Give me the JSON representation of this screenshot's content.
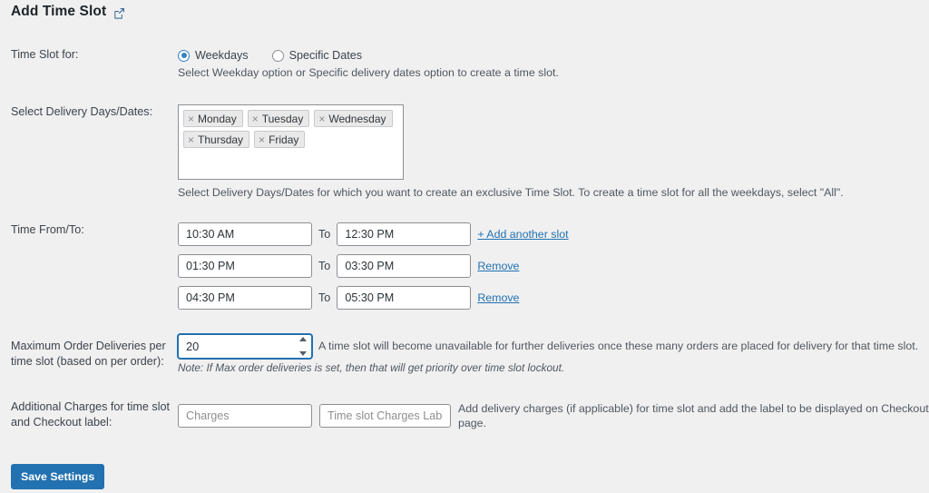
{
  "header": {
    "title": "Add Time Slot",
    "external_link_icon": "external-link-icon"
  },
  "form": {
    "time_slot_for": {
      "label": "Time Slot for:",
      "options": [
        {
          "label": "Weekdays",
          "selected": true
        },
        {
          "label": "Specific Dates",
          "selected": false
        }
      ],
      "help": "Select Weekday option or Specific delivery dates option to create a time slot."
    },
    "delivery_days": {
      "label": "Select Delivery Days/Dates:",
      "tags": [
        "Monday",
        "Tuesday",
        "Wednesday",
        "Thursday",
        "Friday"
      ],
      "remove_glyph": "×",
      "help": "Select Delivery Days/Dates for which you want to create an exclusive Time Slot. To create a time slot for all the weekdays, select \"All\"."
    },
    "time_from_to": {
      "label": "Time From/To:",
      "to_label": "To",
      "add_slot_link": "+ Add another slot",
      "remove_link": "Remove",
      "rows": [
        {
          "from": "10:30 AM",
          "to": "12:30 PM",
          "action": "add"
        },
        {
          "from": "01:30 PM",
          "to": "03:30 PM",
          "action": "remove"
        },
        {
          "from": "04:30 PM",
          "to": "05:30 PM",
          "action": "remove"
        }
      ]
    },
    "max_deliveries": {
      "label": "Maximum Order Deliveries per time slot (based on per order):",
      "value": "20",
      "help": "A time slot will become unavailable for further deliveries once these many orders are placed for delivery for that time slot.",
      "note": "Note: If Max order deliveries is set, then that will get priority over time slot lockout."
    },
    "additional_charges": {
      "label": "Additional Charges for time slot and Checkout label:",
      "charges_placeholder": "Charges",
      "charges_value": "",
      "charges_label_placeholder": "Time slot Charges Label",
      "charges_label_value": "",
      "help": "Add delivery charges (if applicable) for time slot and add the label to be displayed on Checkout page."
    },
    "save_button": "Save Settings"
  },
  "colors": {
    "accent": "#2271b1",
    "background": "#f0f0f1",
    "text": "#3c434a"
  }
}
